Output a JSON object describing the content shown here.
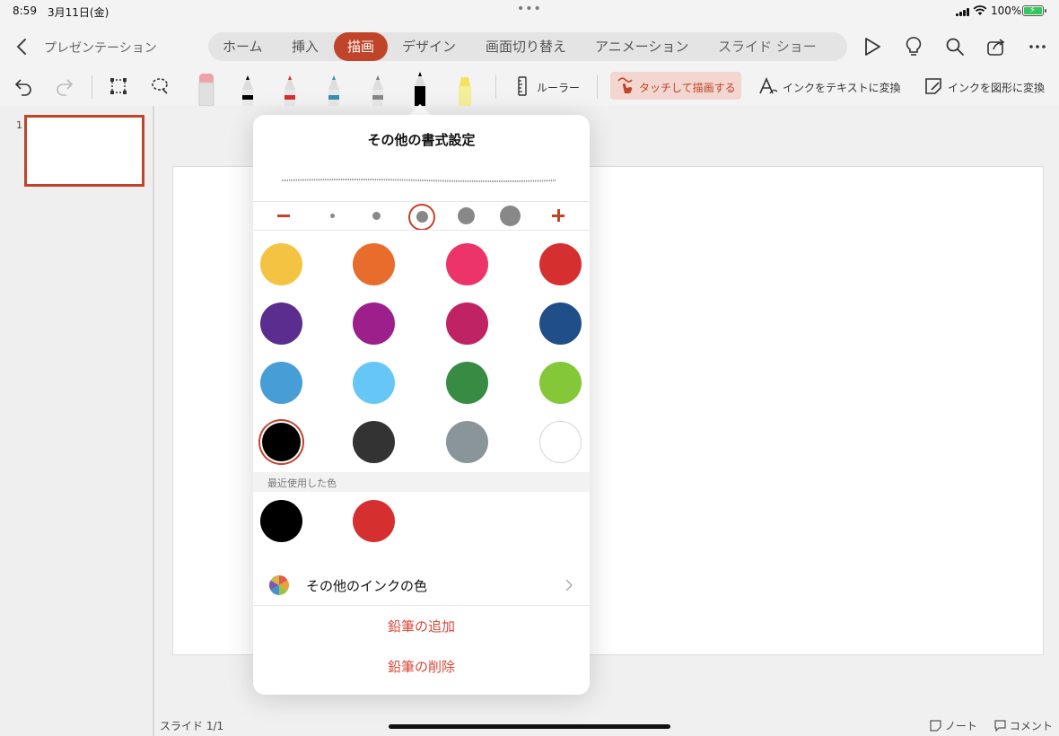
{
  "status_bar": {
    "time": "8:59",
    "date": "3月11日(金)",
    "multitask_dots": "•••",
    "battery_percent": "100%",
    "battery_level": 1.0
  },
  "header": {
    "back_icon": "chevron-left-icon",
    "document_title": "プレゼンテーション",
    "tabs": [
      {
        "label": "ホーム",
        "active": false
      },
      {
        "label": "挿入",
        "active": false
      },
      {
        "label": "描画",
        "active": true
      },
      {
        "label": "デザイン",
        "active": false
      },
      {
        "label": "画面切り替え",
        "active": false
      },
      {
        "label": "アニメーション",
        "active": false
      },
      {
        "label": "スライド ショー",
        "active": false
      }
    ],
    "right_icons": [
      "play-icon",
      "lightbulb-icon",
      "search-icon",
      "share-icon",
      "more-icon"
    ]
  },
  "ribbon": {
    "tools": [
      "undo-icon",
      "redo-icon",
      "select-icon",
      "lasso-icon",
      "eraser",
      "pen-black",
      "pen-red",
      "pen-teal",
      "pencil-gray",
      "pencil-black",
      "highlighter-yellow"
    ],
    "ruler_label": "ルーラー",
    "touch_draw_label": "タッチして描画する",
    "ink_to_text_label": "インクをテキストに変換",
    "ink_to_shape_label": "インクを図形に変換"
  },
  "slides_pane": {
    "thumbnails": [
      {
        "number": "1",
        "selected": true
      }
    ]
  },
  "popover": {
    "title": "その他の書式設定",
    "thickness": {
      "options": 5,
      "selected_index": 2
    },
    "colors": [
      {
        "hex": "#f5c342",
        "selected": false
      },
      {
        "hex": "#e86d2c",
        "selected": false
      },
      {
        "hex": "#ec3468",
        "selected": false
      },
      {
        "hex": "#d62f30",
        "selected": false
      },
      {
        "hex": "#5b2d8e",
        "selected": false
      },
      {
        "hex": "#9c1f8c",
        "selected": false
      },
      {
        "hex": "#c02363",
        "selected": false
      },
      {
        "hex": "#1f4e89",
        "selected": false
      },
      {
        "hex": "#479ed6",
        "selected": false
      },
      {
        "hex": "#66c7f7",
        "selected": false
      },
      {
        "hex": "#388b43",
        "selected": false
      },
      {
        "hex": "#84c83a",
        "selected": false
      },
      {
        "hex": "#000000",
        "selected": true
      },
      {
        "hex": "#333333",
        "selected": false
      },
      {
        "hex": "#8a959a",
        "selected": false
      },
      {
        "hex": "#ffffff",
        "selected": false
      }
    ],
    "recent_header": "最近使用した色",
    "recent_colors": [
      {
        "hex": "#000000"
      },
      {
        "hex": "#d62f30"
      }
    ],
    "more_colors_label": "その他のインクの色",
    "add_pencil_label": "鉛筆の追加",
    "delete_pencil_label": "鉛筆の削除"
  },
  "footer": {
    "slide_status": "スライド 1/1",
    "notes_label": "ノート",
    "comments_label": "コメント"
  },
  "accent_color": "#c0442a"
}
